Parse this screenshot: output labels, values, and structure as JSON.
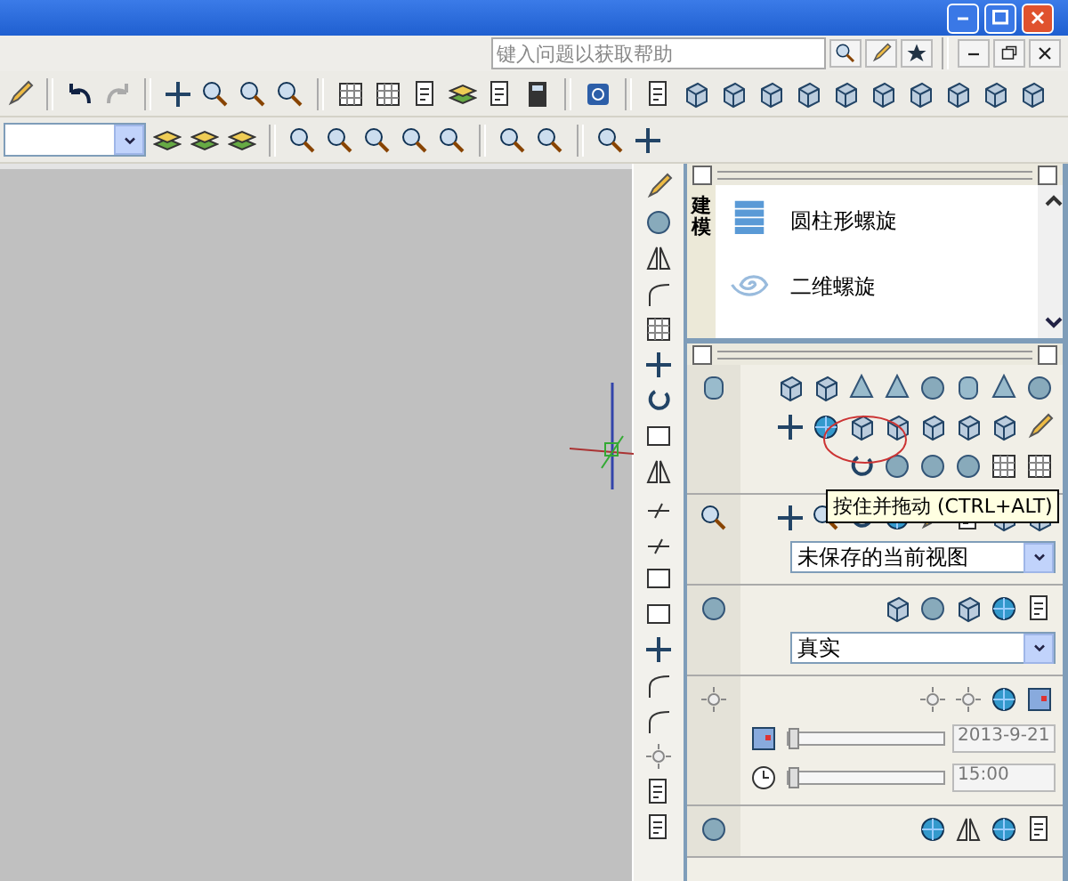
{
  "help_search": {
    "placeholder": "键入问题以获取帮助"
  },
  "tool_palette": {
    "tab": "建模",
    "items": [
      {
        "label": "圆柱形螺旋",
        "kind": "helix"
      },
      {
        "label": "二维螺旋",
        "kind": "spiral"
      }
    ]
  },
  "dashboard": {
    "tooltip": "按住并拖动 (CTRL+ALT)",
    "view": {
      "value": "未保存的当前视图"
    },
    "visual_style": {
      "value": "真实"
    },
    "sun_date": {
      "value": "2013-9-21",
      "disabled": true,
      "level": 0
    },
    "sun_time": {
      "value": "15:00",
      "disabled": true,
      "level": 0
    }
  }
}
